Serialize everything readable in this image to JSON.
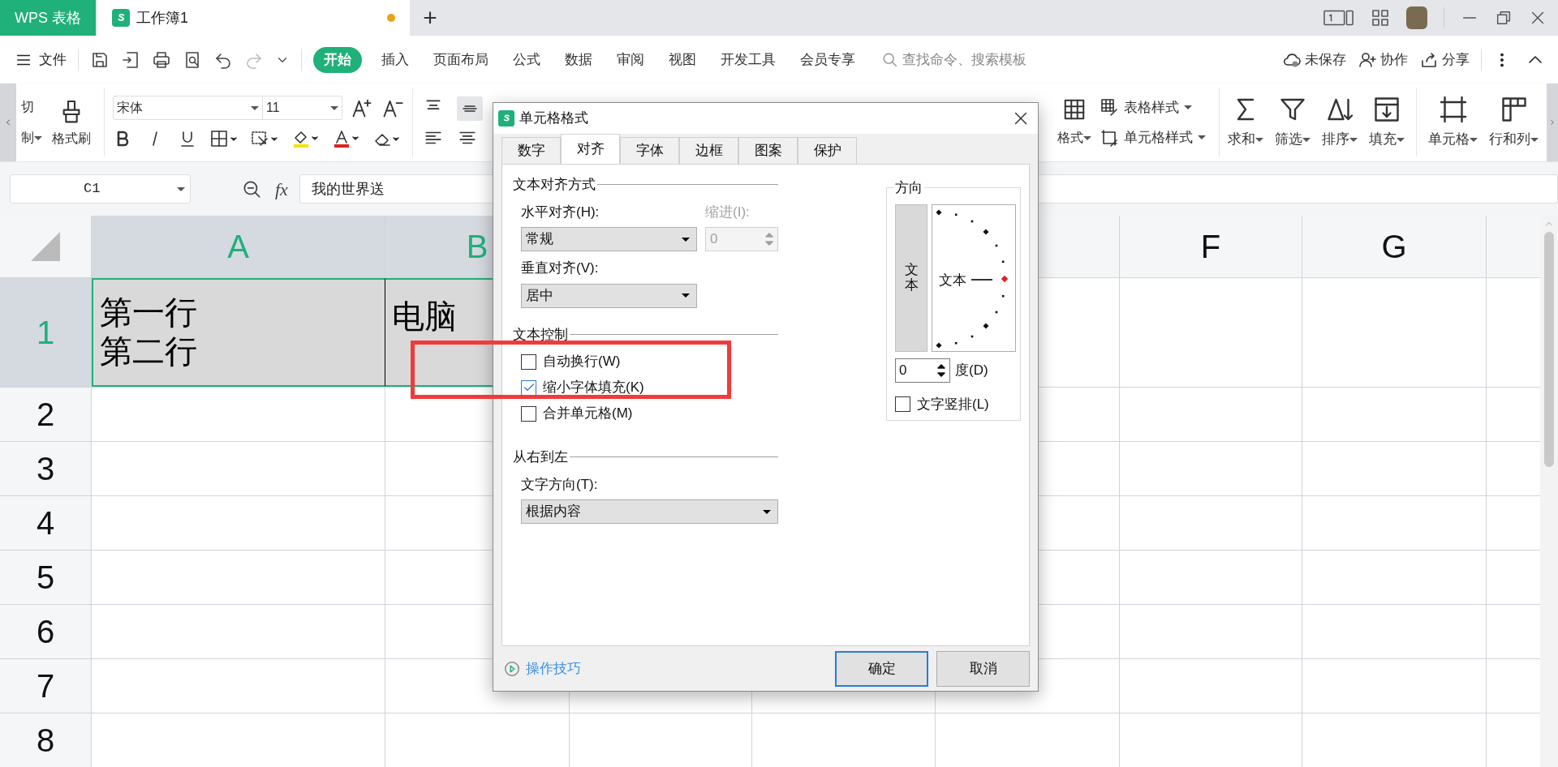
{
  "title_bar": {
    "app_tab": "WPS 表格",
    "doc_tab": {
      "title": "工作簿1",
      "unsaved": true
    },
    "new_tab": "+"
  },
  "menu": {
    "file": "文件",
    "tabs": [
      {
        "label": "开始",
        "selected": true
      },
      {
        "label": "插入",
        "selected": false
      },
      {
        "label": "页面布局",
        "selected": false
      },
      {
        "label": "公式",
        "selected": false
      },
      {
        "label": "数据",
        "selected": false
      },
      {
        "label": "审阅",
        "selected": false
      },
      {
        "label": "视图",
        "selected": false
      },
      {
        "label": "开发工具",
        "selected": false
      },
      {
        "label": "会员专享",
        "selected": false
      }
    ],
    "search": {
      "placeholder": "查找命令、搜索模板"
    },
    "actions": [
      {
        "kind": "cloud",
        "label": "未保存"
      },
      {
        "kind": "collab",
        "label": "协作"
      },
      {
        "kind": "share",
        "label": "分享"
      }
    ]
  },
  "ribbon": {
    "cut": "切",
    "copy": "制",
    "painter": "格式刷",
    "font_name": "宋体",
    "font_size": "11",
    "format_partial": "格式",
    "table_style": "表格样式",
    "cell_style": "单元格样式",
    "tools": [
      {
        "kind": "sum",
        "label": "求和"
      },
      {
        "kind": "filter",
        "label": "筛选"
      },
      {
        "kind": "sort",
        "label": "排序"
      },
      {
        "kind": "fill",
        "label": "填充"
      },
      {
        "kind": "cell",
        "label": "单元格"
      },
      {
        "kind": "rowcol",
        "label": "行和列"
      }
    ]
  },
  "formula_bar": {
    "name_box": "C1",
    "fx": "fx",
    "value": "我的世界送"
  },
  "sheet": {
    "columns": [
      {
        "label": "A",
        "selected": true
      },
      {
        "label": "B",
        "selected": true
      },
      {
        "label": "F",
        "selected": false
      },
      {
        "label": "G",
        "selected": false
      }
    ],
    "rows": [
      {
        "label": "1",
        "selected": true,
        "cells": [
          [
            "第一行",
            "第二行"
          ],
          [
            "电脑"
          ]
        ]
      },
      {
        "label": "2",
        "selected": false
      },
      {
        "label": "3",
        "selected": false
      },
      {
        "label": "4",
        "selected": false
      },
      {
        "label": "5",
        "selected": false
      },
      {
        "label": "6",
        "selected": false
      },
      {
        "label": "7",
        "selected": false
      },
      {
        "label": "8",
        "selected": false
      }
    ]
  },
  "dialog": {
    "title": "单元格格式",
    "tabs": [
      {
        "label": "数字",
        "selected": false
      },
      {
        "label": "对齐",
        "selected": true
      },
      {
        "label": "字体",
        "selected": false
      },
      {
        "label": "边框",
        "selected": false
      },
      {
        "label": "图案",
        "selected": false
      },
      {
        "label": "保护",
        "selected": false
      }
    ],
    "alignment": {
      "heading": "文本对齐方式",
      "horizontal": {
        "label": "水平对齐(H):",
        "value": "常规"
      },
      "indent": {
        "label": "缩进(I):",
        "value": "0",
        "disabled": true
      },
      "vertical": {
        "label": "垂直对齐(V):",
        "value": "居中"
      }
    },
    "control": {
      "heading": "文本控制",
      "options": [
        {
          "label": "自动换行(W)",
          "checked": false
        },
        {
          "label": "缩小字体填充(K)",
          "checked": true
        },
        {
          "label": "合并单元格(M)",
          "checked": false
        }
      ]
    },
    "rtl": {
      "heading": "从右到左",
      "direction": {
        "label": "文字方向(T):",
        "value": "根据内容"
      }
    },
    "orientation": {
      "heading": "方向",
      "vertical_text": "文本",
      "dial_text": "文本",
      "degrees": {
        "value": "0",
        "label": "度(D)"
      },
      "stacked": {
        "label": "文字竖排(L)",
        "checked": false
      }
    },
    "tips": "操作技巧",
    "buttons": [
      {
        "label": "确定",
        "default": true
      },
      {
        "label": "取消",
        "default": false
      }
    ]
  }
}
